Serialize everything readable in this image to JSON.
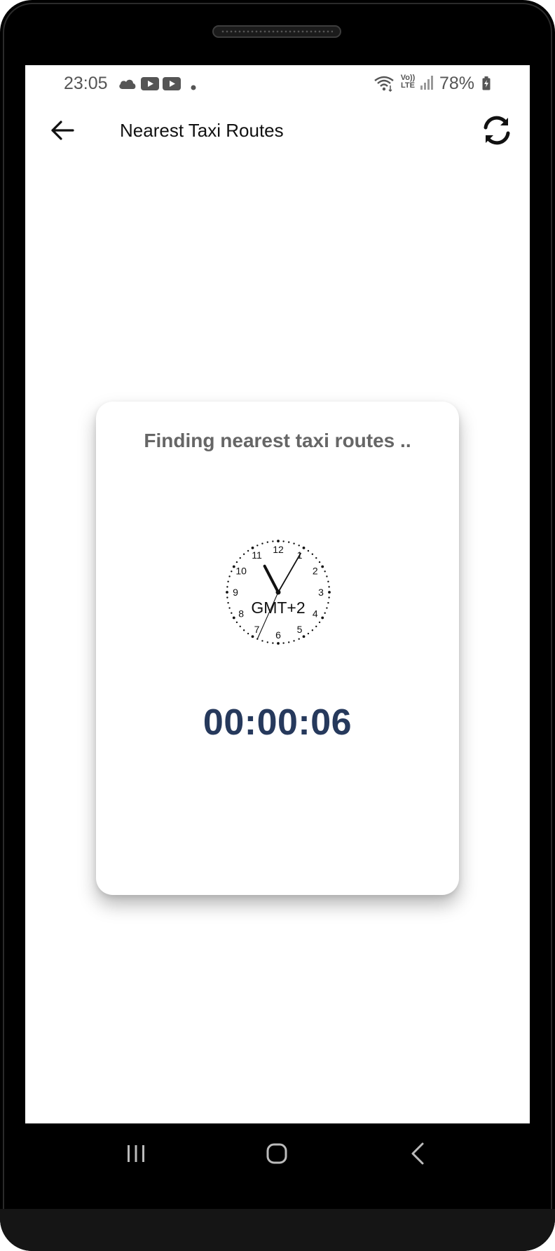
{
  "status_bar": {
    "time": "23:05",
    "left_icons": [
      "cloud-icon",
      "youtube-icon",
      "youtube-icon",
      "dot-icon"
    ],
    "right_icons": [
      "wifi-icon",
      "volte-lte-icon",
      "signal-icon",
      "battery-charging-icon"
    ],
    "battery": "78%",
    "volte_label_top": "Vo))",
    "volte_label_bottom": "LTE"
  },
  "app_bar": {
    "title": "Nearest Taxi Routes",
    "back_icon": "arrow-left-icon",
    "refresh_icon": "refresh-icon"
  },
  "card": {
    "message": "Finding nearest taxi routes ..",
    "clock": {
      "timezone_label": "GMT+2",
      "numbers": [
        "12",
        "1",
        "2",
        "3",
        "4",
        "5",
        "6",
        "7",
        "8",
        "9",
        "10",
        "11"
      ],
      "hour": 11,
      "minute": 5,
      "second": 34
    },
    "timer": "00:00:06"
  },
  "nav_bar": {
    "icons": [
      "recent-apps-icon",
      "home-icon",
      "back-icon"
    ]
  },
  "colors": {
    "message_text": "#666666",
    "timer_text": "#26395c",
    "status_text": "#555555",
    "frame": "#000000"
  }
}
